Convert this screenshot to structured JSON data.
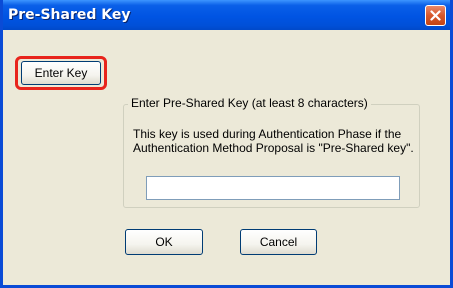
{
  "window": {
    "title": "Pre-Shared Key"
  },
  "buttons": {
    "enter_key": "Enter Key",
    "ok": "OK",
    "cancel": "Cancel"
  },
  "group": {
    "legend": "Enter Pre-Shared Key (at least 8 characters)",
    "description": "This key is used during Authentication Phase if the Authentication Method Proposal is \"Pre-Shared key\"."
  },
  "key_input": {
    "value": ""
  },
  "icons": {
    "close": "close-icon"
  },
  "colors": {
    "titlebar": "#0054e3",
    "dialog_bg": "#ece9d8",
    "highlight": "#e8241c",
    "close_button": "#d7582c"
  }
}
